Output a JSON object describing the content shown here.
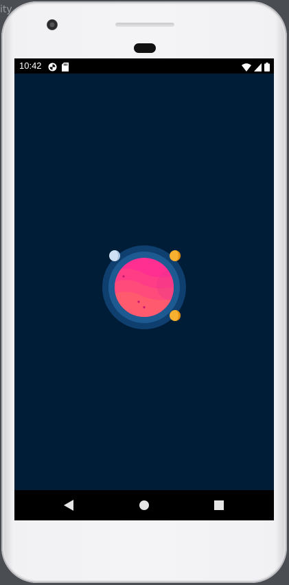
{
  "background": {
    "partial_text": "ity"
  },
  "statusbar": {
    "time": "10:42",
    "left_icons": [
      "sync-icon",
      "sd-card-icon"
    ],
    "right_icons": [
      "wifi-icon",
      "cell-signal-icon",
      "battery-icon"
    ]
  },
  "app": {
    "background_color": "#001d38",
    "planet": {
      "body_colors": [
        "#ff2f92",
        "#ff5a6e"
      ],
      "halo_colors": [
        "#0f3f6e",
        "#1d5a92"
      ],
      "moons": [
        {
          "name": "moon-white",
          "color": "#cfe0f4"
        },
        {
          "name": "moon-orange-top",
          "color": "#f7b02f"
        },
        {
          "name": "moon-orange-bottom",
          "color": "#f7b02f"
        }
      ]
    }
  },
  "navbar": {
    "buttons": [
      "back-icon",
      "home-icon",
      "recents-icon"
    ]
  }
}
